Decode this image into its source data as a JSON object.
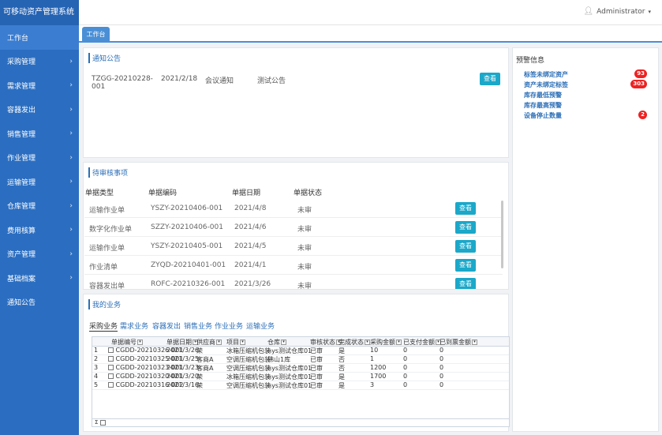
{
  "app": {
    "title": "可移动资产管理系统",
    "user": "Administrator"
  },
  "sidebar": {
    "items": [
      {
        "label": "工作台",
        "chev": false
      },
      {
        "label": "采购管理",
        "chev": true
      },
      {
        "label": "需求管理",
        "chev": true
      },
      {
        "label": "容器发出",
        "chev": true
      },
      {
        "label": "销售管理",
        "chev": true
      },
      {
        "label": "作业管理",
        "chev": true
      },
      {
        "label": "运输管理",
        "chev": true
      },
      {
        "label": "仓库管理",
        "chev": true
      },
      {
        "label": "费用核算",
        "chev": true
      },
      {
        "label": "资产管理",
        "chev": true
      },
      {
        "label": "基础档案",
        "chev": true
      },
      {
        "label": "通知公告",
        "chev": false
      }
    ]
  },
  "tabs": {
    "work": "工作台"
  },
  "notice": {
    "title": "通知公告",
    "code": "TZGG-20210228-001",
    "date": "2021/2/18",
    "type": "会议通知",
    "subject": "测试公告",
    "view": "查看"
  },
  "warning": {
    "title": "预警信息",
    "items": [
      {
        "label": "标签未绑定资产",
        "count": "93"
      },
      {
        "label": "资产未绑定标签",
        "count": "303"
      },
      {
        "label": "库存最低预警",
        "count": ""
      },
      {
        "label": "库存最高预警",
        "count": ""
      },
      {
        "label": "设备停止数量",
        "count": "2"
      }
    ]
  },
  "pending": {
    "title": "待审核事项",
    "headers": [
      "单据类型",
      "单据编码",
      "单据日期",
      "单据状态"
    ],
    "view": "查看",
    "rows": [
      {
        "type": "运输作业单",
        "code": "YSZY-20210406-001",
        "date": "2021/4/8",
        "status": "未审"
      },
      {
        "type": "数字化作业单",
        "code": "SZZY-20210406-001",
        "date": "2021/4/6",
        "status": "未审"
      },
      {
        "type": "运输作业单",
        "code": "YSZY-20210405-001",
        "date": "2021/4/5",
        "status": "未审"
      },
      {
        "type": "作业清单",
        "code": "ZYQD-20210401-001",
        "date": "2021/4/1",
        "status": "未审"
      },
      {
        "type": "容器发出单",
        "code": "ROFC-20210326-001",
        "date": "2021/3/26",
        "status": "未审"
      }
    ]
  },
  "mybiz": {
    "title": "我的业务",
    "tabs": [
      "采购业务",
      "需求业务",
      "容器发出",
      "销售业务",
      "作业业务",
      "运输业务"
    ],
    "headers": [
      "单据编号",
      "单据日期",
      "供应商",
      "项目",
      "仓库",
      "审核状态",
      "完成状态",
      "采购金额",
      "已支付金额",
      "已到票金额"
    ],
    "rows": [
      [
        "1",
        "CGDD-20210326-001",
        "2021/3/26",
        "荣",
        "冰箱压缩机包装",
        "hys测试仓库01",
        "已审",
        "是",
        "10",
        "0",
        "0"
      ],
      [
        "2",
        "CGDD-20210325-001",
        "2021/3/25",
        "客商A",
        "空调压缩机包装",
        "佛山1库",
        "已审",
        "否",
        "1",
        "0",
        "0"
      ],
      [
        "3",
        "CGDD-20210323-001",
        "2021/3/23",
        "客商A",
        "空调压缩机包装",
        "hys测试仓库01",
        "已审",
        "否",
        "1200",
        "0",
        "0"
      ],
      [
        "4",
        "CGDD-20210320-001",
        "2021/3/20",
        "荣",
        "冰箱压缩机包装",
        "hys测试仓库01",
        "已审",
        "是",
        "1700",
        "0",
        "0"
      ],
      [
        "5",
        "CGDD-20210316-002",
        "2021/3/16",
        "荣",
        "空调压缩机包装",
        "hys测试仓库01",
        "已审",
        "是",
        "3",
        "0",
        "0"
      ]
    ],
    "footer": "Σ"
  }
}
